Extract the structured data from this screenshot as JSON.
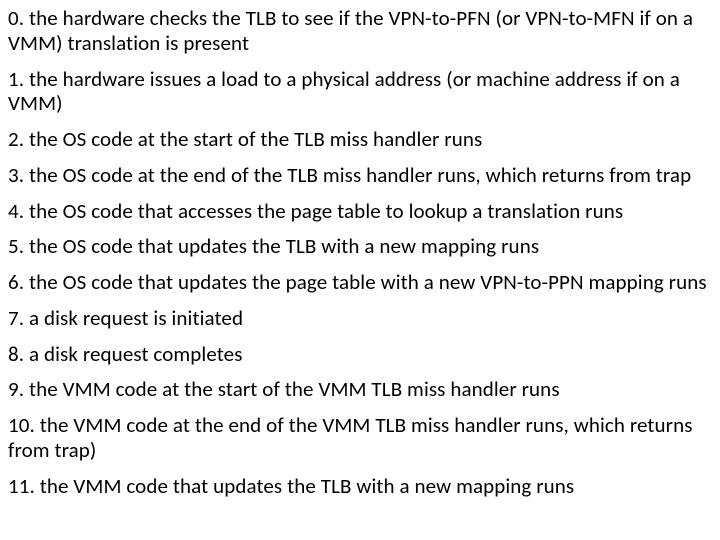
{
  "items": [
    "0. the hardware checks the TLB to see if the VPN-to-PFN (or VPN-to-MFN if on a VMM) translation is present",
    "1. the hardware issues a load to a physical address (or machine address if on a VMM)",
    "2. the OS code at the start of the TLB miss handler runs",
    "3. the OS code at the end of the TLB miss handler runs, which returns from trap",
    "4. the OS code that accesses the page table to lookup a translation runs",
    "5. the OS code that updates the TLB with a new mapping runs",
    "6. the OS code that updates the page table with a new VPN-to-PPN mapping runs",
    "7. a disk request is initiated",
    "8. a disk request completes",
    "9. the VMM code at the start of the VMM TLB miss handler runs",
    "10. the VMM code at the end of the VMM TLB miss handler runs, which returns from trap)",
    "11. the VMM code that updates the TLB with a new mapping runs"
  ]
}
